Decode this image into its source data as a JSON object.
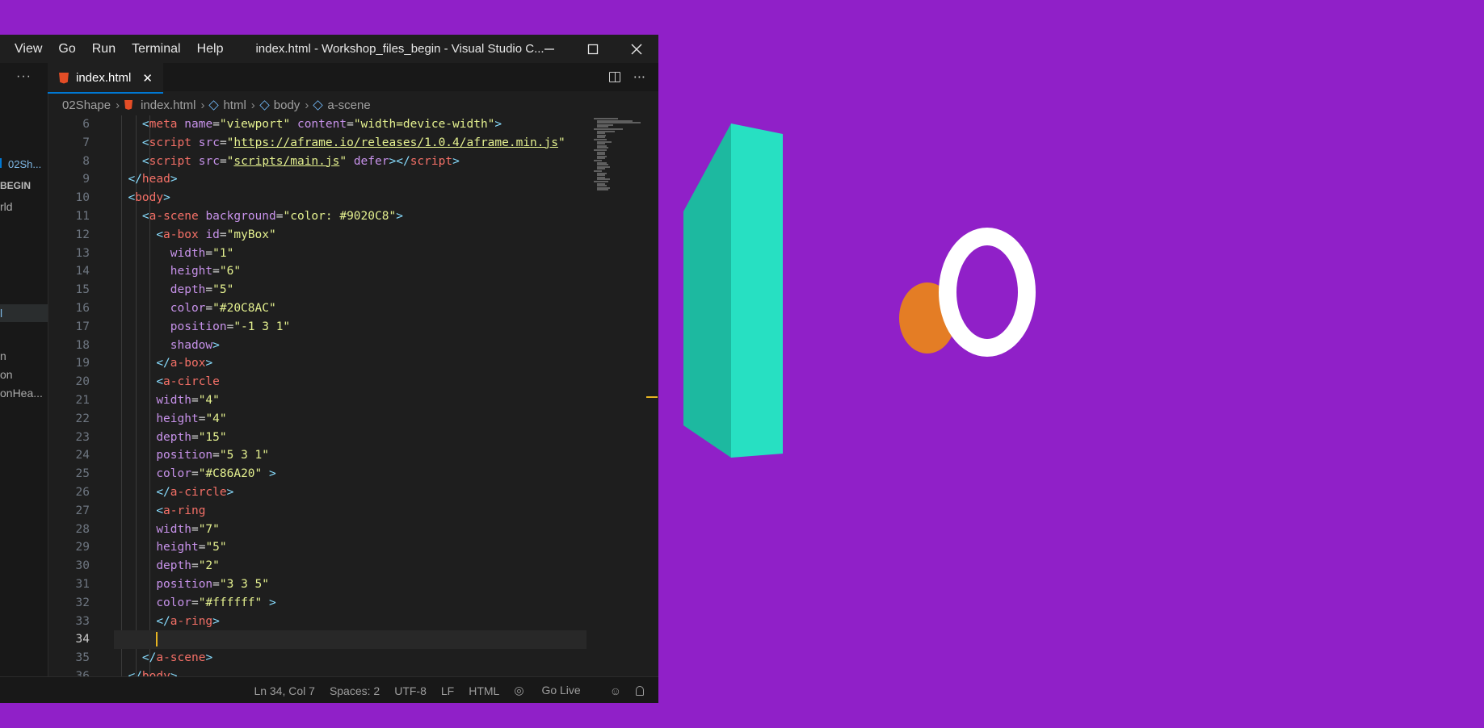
{
  "window": {
    "title": "index.html - Workshop_files_begin - Visual Studio C...",
    "menu": [
      "View",
      "Go",
      "Run",
      "Terminal",
      "Help"
    ]
  },
  "sidebar": {
    "more_label": "···",
    "items": [
      {
        "label": "02Sh..."
      },
      {
        "label": "BEGIN"
      },
      {
        "label": "rld"
      },
      {
        "label": "l"
      },
      {
        "label": "n"
      },
      {
        "label": "on"
      },
      {
        "label": "onHea..."
      }
    ]
  },
  "tab": {
    "label": "index.html",
    "close_label": "✕"
  },
  "tab_actions": {
    "more_label": "···"
  },
  "breadcrumbs": [
    "02Shape",
    "index.html",
    "html",
    "body",
    "a-scene"
  ],
  "editor": {
    "current_line": 34,
    "lines": [
      {
        "n": "6",
        "indent": 4,
        "tokens": [
          [
            "t-br",
            "<"
          ],
          [
            "t-tag",
            "meta"
          ],
          [
            "t-pl",
            " "
          ],
          [
            "t-attr",
            "name"
          ],
          [
            "t-pl",
            "="
          ],
          [
            "t-str",
            "\"viewport\""
          ],
          [
            "t-pl",
            " "
          ],
          [
            "t-attr",
            "content"
          ],
          [
            "t-pl",
            "="
          ],
          [
            "t-str",
            "\"width=device-width\""
          ],
          [
            "t-br",
            ">"
          ]
        ]
      },
      {
        "n": "7",
        "indent": 4,
        "tokens": [
          [
            "t-br",
            "<"
          ],
          [
            "t-tag",
            "script"
          ],
          [
            "t-pl",
            " "
          ],
          [
            "t-attr",
            "src"
          ],
          [
            "t-pl",
            "="
          ],
          [
            "t-str",
            "\""
          ],
          [
            "t-url",
            "https://aframe.io/releases/1.0.4/aframe.min.js"
          ],
          [
            "t-str",
            "\""
          ]
        ]
      },
      {
        "n": "8",
        "indent": 4,
        "tokens": [
          [
            "t-br",
            "<"
          ],
          [
            "t-tag",
            "script"
          ],
          [
            "t-pl",
            " "
          ],
          [
            "t-attr",
            "src"
          ],
          [
            "t-pl",
            "="
          ],
          [
            "t-str",
            "\""
          ],
          [
            "t-url",
            "scripts/main.js"
          ],
          [
            "t-str",
            "\""
          ],
          [
            "t-pl",
            " "
          ],
          [
            "t-attr",
            "defer"
          ],
          [
            "t-br",
            "></"
          ],
          [
            "t-tag",
            "script"
          ],
          [
            "t-br",
            ">"
          ]
        ]
      },
      {
        "n": "9",
        "indent": 2,
        "tokens": [
          [
            "t-br",
            "</"
          ],
          [
            "t-tag",
            "head"
          ],
          [
            "t-br",
            ">"
          ]
        ]
      },
      {
        "n": "10",
        "indent": 2,
        "tokens": [
          [
            "t-br",
            "<"
          ],
          [
            "t-tag",
            "body"
          ],
          [
            "t-br",
            ">"
          ]
        ]
      },
      {
        "n": "11",
        "indent": 4,
        "tokens": [
          [
            "t-br",
            "<"
          ],
          [
            "t-tag",
            "a-scene"
          ],
          [
            "t-pl",
            " "
          ],
          [
            "t-attr",
            "background"
          ],
          [
            "t-pl",
            "="
          ],
          [
            "t-str",
            "\"color: #9020C8\""
          ],
          [
            "t-br",
            ">"
          ]
        ]
      },
      {
        "n": "12",
        "indent": 6,
        "tokens": [
          [
            "t-br",
            "<"
          ],
          [
            "t-tag",
            "a-box"
          ],
          [
            "t-pl",
            " "
          ],
          [
            "t-attr",
            "id"
          ],
          [
            "t-pl",
            "="
          ],
          [
            "t-str",
            "\"myBox\""
          ]
        ]
      },
      {
        "n": "13",
        "indent": 8,
        "tokens": [
          [
            "t-attr",
            "width"
          ],
          [
            "t-pl",
            "="
          ],
          [
            "t-str",
            "\"1\""
          ]
        ]
      },
      {
        "n": "14",
        "indent": 8,
        "tokens": [
          [
            "t-attr",
            "height"
          ],
          [
            "t-pl",
            "="
          ],
          [
            "t-str",
            "\"6\""
          ]
        ]
      },
      {
        "n": "15",
        "indent": 8,
        "tokens": [
          [
            "t-attr",
            "depth"
          ],
          [
            "t-pl",
            "="
          ],
          [
            "t-str",
            "\"5\""
          ]
        ]
      },
      {
        "n": "16",
        "indent": 8,
        "tokens": [
          [
            "t-attr",
            "color"
          ],
          [
            "t-pl",
            "="
          ],
          [
            "t-str",
            "\"#20C8AC\""
          ]
        ]
      },
      {
        "n": "17",
        "indent": 8,
        "tokens": [
          [
            "t-attr",
            "position"
          ],
          [
            "t-pl",
            "="
          ],
          [
            "t-str",
            "\"-1 3 1\""
          ]
        ]
      },
      {
        "n": "18",
        "indent": 8,
        "tokens": [
          [
            "t-attr",
            "shadow"
          ],
          [
            "t-br",
            ">"
          ]
        ]
      },
      {
        "n": "19",
        "indent": 6,
        "tokens": [
          [
            "t-br",
            "</"
          ],
          [
            "t-tag",
            "a-box"
          ],
          [
            "t-br",
            ">"
          ]
        ]
      },
      {
        "n": "20",
        "indent": 6,
        "tokens": [
          [
            "t-br",
            "<"
          ],
          [
            "t-tag",
            "a-circle"
          ]
        ]
      },
      {
        "n": "21",
        "indent": 6,
        "tokens": [
          [
            "t-attr",
            "width"
          ],
          [
            "t-pl",
            "="
          ],
          [
            "t-str",
            "\"4\""
          ]
        ]
      },
      {
        "n": "22",
        "indent": 6,
        "tokens": [
          [
            "t-attr",
            "height"
          ],
          [
            "t-pl",
            "="
          ],
          [
            "t-str",
            "\"4\""
          ]
        ]
      },
      {
        "n": "23",
        "indent": 6,
        "tokens": [
          [
            "t-attr",
            "depth"
          ],
          [
            "t-pl",
            "="
          ],
          [
            "t-str",
            "\"15\""
          ]
        ]
      },
      {
        "n": "24",
        "indent": 6,
        "tokens": [
          [
            "t-attr",
            "position"
          ],
          [
            "t-pl",
            "="
          ],
          [
            "t-str",
            "\"5 3 1\""
          ]
        ]
      },
      {
        "n": "25",
        "indent": 6,
        "tokens": [
          [
            "t-attr",
            "color"
          ],
          [
            "t-pl",
            "="
          ],
          [
            "t-str",
            "\"#C86A20\""
          ],
          [
            "t-pl",
            " "
          ],
          [
            "t-br",
            ">"
          ]
        ]
      },
      {
        "n": "26",
        "indent": 6,
        "tokens": [
          [
            "t-br",
            "</"
          ],
          [
            "t-tag",
            "a-circle"
          ],
          [
            "t-br",
            ">"
          ]
        ]
      },
      {
        "n": "27",
        "indent": 6,
        "tokens": [
          [
            "t-br",
            "<"
          ],
          [
            "t-tag",
            "a-ring"
          ]
        ]
      },
      {
        "n": "28",
        "indent": 6,
        "tokens": [
          [
            "t-attr",
            "width"
          ],
          [
            "t-pl",
            "="
          ],
          [
            "t-str",
            "\"7\""
          ]
        ]
      },
      {
        "n": "29",
        "indent": 6,
        "tokens": [
          [
            "t-attr",
            "height"
          ],
          [
            "t-pl",
            "="
          ],
          [
            "t-str",
            "\"5\""
          ]
        ]
      },
      {
        "n": "30",
        "indent": 6,
        "tokens": [
          [
            "t-attr",
            "depth"
          ],
          [
            "t-pl",
            "="
          ],
          [
            "t-str",
            "\"2\""
          ]
        ]
      },
      {
        "n": "31",
        "indent": 6,
        "tokens": [
          [
            "t-attr",
            "position"
          ],
          [
            "t-pl",
            "="
          ],
          [
            "t-str",
            "\"3 3 5\""
          ]
        ]
      },
      {
        "n": "32",
        "indent": 6,
        "tokens": [
          [
            "t-attr",
            "color"
          ],
          [
            "t-pl",
            "="
          ],
          [
            "t-str",
            "\"#ffffff\""
          ],
          [
            "t-pl",
            " "
          ],
          [
            "t-br",
            ">"
          ]
        ]
      },
      {
        "n": "33",
        "indent": 6,
        "tokens": [
          [
            "t-br",
            "</"
          ],
          [
            "t-tag",
            "a-ring"
          ],
          [
            "t-br",
            ">"
          ]
        ]
      },
      {
        "n": "34",
        "indent": 6,
        "tokens": []
      },
      {
        "n": "35",
        "indent": 4,
        "tokens": [
          [
            "t-br",
            "</"
          ],
          [
            "t-tag",
            "a-scene"
          ],
          [
            "t-br",
            ">"
          ]
        ]
      },
      {
        "n": "36",
        "indent": 2,
        "tokens": [
          [
            "t-br",
            "</"
          ],
          [
            "t-tag",
            "body"
          ],
          [
            "t-br",
            ">"
          ]
        ]
      }
    ]
  },
  "statusbar": {
    "position": "Ln 34, Col 7",
    "spaces": "Spaces: 2",
    "encoding": "UTF-8",
    "eol": "LF",
    "language": "HTML",
    "golive": "Go Live"
  },
  "scene": {
    "background": "#9020C8",
    "box_color": "#20C8AC",
    "circle_color": "#C86A20",
    "ring_color": "#ffffff"
  }
}
